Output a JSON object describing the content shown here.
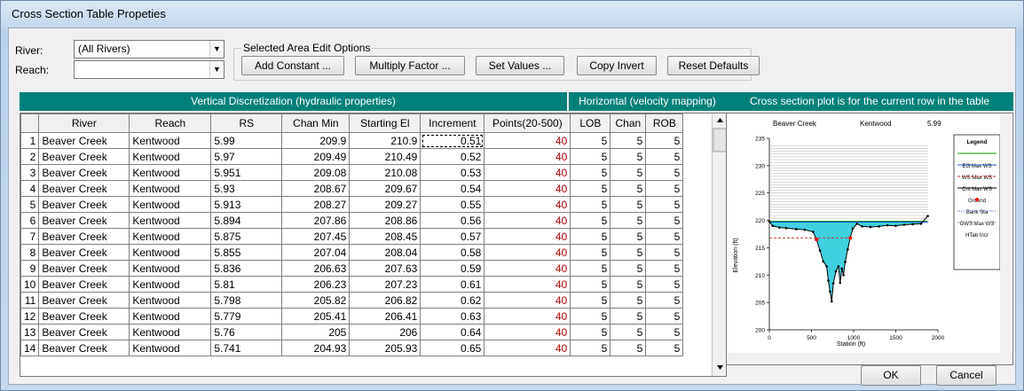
{
  "window": {
    "title": "Cross Section Table Propeties"
  },
  "filters": {
    "river_label": "River:",
    "river_value": "(All Rivers)",
    "reach_label": "Reach:",
    "reach_value": ""
  },
  "edit_options": {
    "legend": "Selected Area Edit Options",
    "add_constant": "Add Constant ...",
    "multiply_factor": "Multiply Factor ...",
    "set_values": "Set Values ...",
    "copy_invert": "Copy Invert",
    "reset_defaults": "Reset Defaults"
  },
  "headers": {
    "vertical": "Vertical Discretization (hydraulic properties)",
    "horizontal": "Horizontal (velocity mapping)",
    "plot": "Cross section plot is for the current row in the table"
  },
  "table": {
    "columns": [
      "",
      "River",
      "Reach",
      "RS",
      "Chan Min",
      "Starting El",
      "Increment",
      "Points(20-500)",
      "LOB",
      "Chan",
      "ROB"
    ],
    "rows": [
      [
        "1",
        "Beaver Creek",
        "Kentwood",
        "5.99",
        "209.9",
        "210.9",
        "0.51",
        "40",
        "5",
        "5",
        "5"
      ],
      [
        "2",
        "Beaver Creek",
        "Kentwood",
        "5.97",
        "209.49",
        "210.49",
        "0.52",
        "40",
        "5",
        "5",
        "5"
      ],
      [
        "3",
        "Beaver Creek",
        "Kentwood",
        "5.951",
        "209.08",
        "210.08",
        "0.53",
        "40",
        "5",
        "5",
        "5"
      ],
      [
        "4",
        "Beaver Creek",
        "Kentwood",
        "5.93",
        "208.67",
        "209.67",
        "0.54",
        "40",
        "5",
        "5",
        "5"
      ],
      [
        "5",
        "Beaver Creek",
        "Kentwood",
        "5.913",
        "208.27",
        "209.27",
        "0.55",
        "40",
        "5",
        "5",
        "5"
      ],
      [
        "6",
        "Beaver Creek",
        "Kentwood",
        "5.894",
        "207.86",
        "208.86",
        "0.56",
        "40",
        "5",
        "5",
        "5"
      ],
      [
        "7",
        "Beaver Creek",
        "Kentwood",
        "5.875",
        "207.45",
        "208.45",
        "0.57",
        "40",
        "5",
        "5",
        "5"
      ],
      [
        "8",
        "Beaver Creek",
        "Kentwood",
        "5.855",
        "207.04",
        "208.04",
        "0.58",
        "40",
        "5",
        "5",
        "5"
      ],
      [
        "9",
        "Beaver Creek",
        "Kentwood",
        "5.836",
        "206.63",
        "207.63",
        "0.59",
        "40",
        "5",
        "5",
        "5"
      ],
      [
        "10",
        "Beaver Creek",
        "Kentwood",
        "5.81",
        "206.23",
        "207.23",
        "0.61",
        "40",
        "5",
        "5",
        "5"
      ],
      [
        "11",
        "Beaver Creek",
        "Kentwood",
        "5.798",
        "205.82",
        "206.82",
        "0.62",
        "40",
        "5",
        "5",
        "5"
      ],
      [
        "12",
        "Beaver Creek",
        "Kentwood",
        "5.779",
        "205.41",
        "206.41",
        "0.63",
        "40",
        "5",
        "5",
        "5"
      ],
      [
        "13",
        "Beaver Creek",
        "Kentwood",
        "5.76",
        "205",
        "206",
        "0.64",
        "40",
        "5",
        "5",
        "5"
      ],
      [
        "14",
        "Beaver Creek",
        "Kentwood",
        "5.741",
        "204.93",
        "205.93",
        "0.65",
        "40",
        "5",
        "5",
        "5"
      ]
    ]
  },
  "plot": {
    "river": "Beaver Creek",
    "reach": "Kentwood",
    "rs": "5.99",
    "ylabel": "Elevation (ft)",
    "xlabel": "Station (ft)",
    "yticks": [
      "200",
      "205",
      "210",
      "215",
      "220",
      "225",
      "230",
      "235"
    ],
    "xticks": [
      "0",
      "500",
      "1000",
      "1500",
      "2000"
    ],
    "legend_title": "Legend",
    "legend_items": [
      "EG Max WS",
      "WS Max WS",
      "Crit Max WS",
      "Ground",
      "Bank Sta",
      "OWS Max WS",
      "HTab Incr"
    ],
    "colors": {
      "eg": "#00a000",
      "ws": "#2050d0",
      "crit": "#d02020",
      "water": "#40d0e0",
      "ground": "#000000",
      "bank": "#ff0000",
      "htab": "#b0b0b0"
    }
  },
  "buttons": {
    "ok": "OK",
    "cancel": "Cancel"
  }
}
